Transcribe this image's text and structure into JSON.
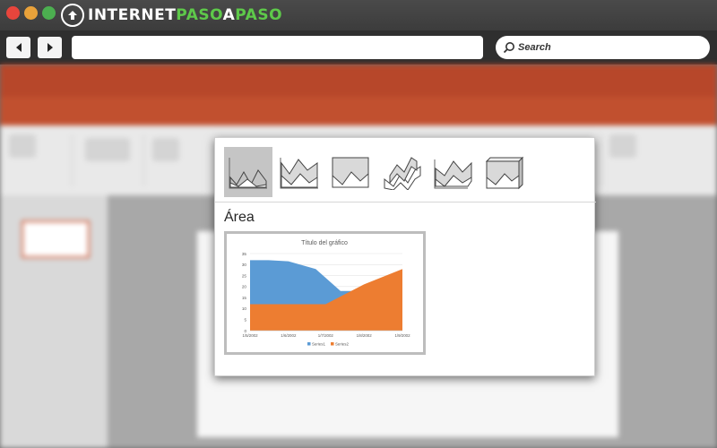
{
  "browser": {
    "logo": {
      "part1": "INTERNET",
      "part2": "PASO",
      "a": "A",
      "part3": "PASO"
    },
    "search_label": "Search"
  },
  "popup": {
    "chart_types": [
      {
        "name": "area",
        "selected": true
      },
      {
        "name": "stacked-area",
        "selected": false
      },
      {
        "name": "100-stacked-area",
        "selected": false
      },
      {
        "name": "3d-area",
        "selected": false
      },
      {
        "name": "3d-stacked-area",
        "selected": false
      },
      {
        "name": "3d-100-stacked-area",
        "selected": false
      }
    ],
    "heading": "Área"
  },
  "chart_data": {
    "type": "area",
    "title": "Título del gráfico",
    "categories": [
      "1/5/2002",
      "1/6/2002",
      "1/7/2002",
      "1/8/2002",
      "1/9/2002"
    ],
    "x": [
      0,
      31,
      61,
      92,
      123
    ],
    "series": [
      {
        "name": "Series1",
        "color": "#5b9bd5",
        "points": [
          [
            0,
            32
          ],
          [
            15,
            32
          ],
          [
            31,
            31.5
          ],
          [
            53,
            28
          ],
          [
            73,
            18
          ],
          [
            123,
            18
          ]
        ]
      },
      {
        "name": "Series2",
        "color": "#ed7d31",
        "points": [
          [
            0,
            12
          ],
          [
            31,
            12
          ],
          [
            61,
            12
          ],
          [
            92,
            21
          ],
          [
            123,
            28
          ]
        ]
      }
    ],
    "ylim": [
      0,
      35
    ],
    "yticks": [
      0,
      5,
      10,
      15,
      20,
      25,
      30,
      35
    ],
    "legend": "bottom",
    "grid": true
  }
}
